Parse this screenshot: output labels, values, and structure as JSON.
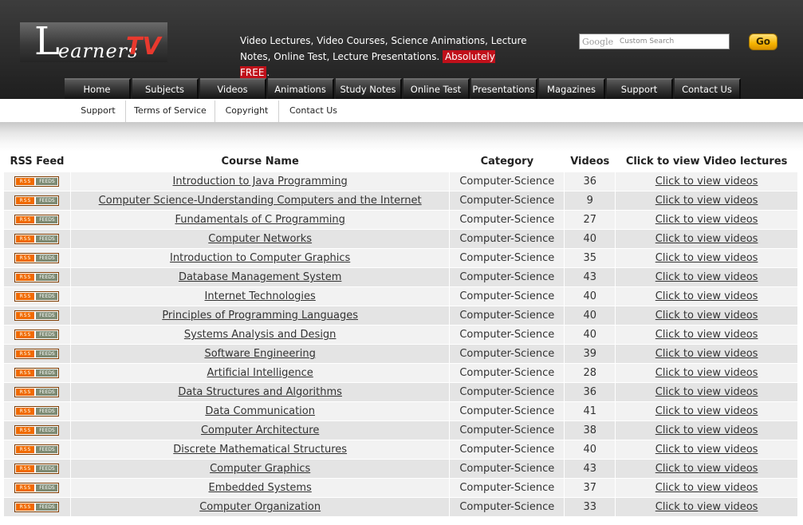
{
  "brand": {
    "logo_l": "L",
    "logo_learners": "earners",
    "logo_tv": "TV"
  },
  "tagline": {
    "text": "Video Lectures, Video Courses, Science Animations, Lecture Notes, Online Test, Lecture Presentations.",
    "highlight": "Absolutely FREE",
    "end": "."
  },
  "search": {
    "google_mark": "Google",
    "custom_search": "Custom Search",
    "go_label": "Go"
  },
  "nav": [
    {
      "label": "Home"
    },
    {
      "label": "Subjects"
    },
    {
      "label": "Videos"
    },
    {
      "label": "Animations"
    },
    {
      "label": "Study Notes"
    },
    {
      "label": "Online Test"
    },
    {
      "label": "Presentations"
    },
    {
      "label": "Magazines"
    },
    {
      "label": "Support"
    },
    {
      "label": "Contact Us"
    }
  ],
  "subnav": [
    {
      "label": "Support"
    },
    {
      "label": "Terms of Service"
    },
    {
      "label": "Copyright"
    },
    {
      "label": "Contact Us"
    }
  ],
  "table": {
    "headers": [
      "RSS Feed",
      "Course Name",
      "Category",
      "Videos",
      "Click to view Video lectures"
    ],
    "rss_left": "RSS",
    "rss_right": "FEEDS",
    "link_text": "Click to view videos",
    "rows": [
      {
        "course": "Introduction to Java Programming",
        "category": "Computer-Science",
        "videos": "36"
      },
      {
        "course": "Computer Science-Understanding Computers and the Internet",
        "category": "Computer-Science",
        "videos": "9"
      },
      {
        "course": "Fundamentals of C Programming",
        "category": "Computer-Science",
        "videos": "27"
      },
      {
        "course": "Computer Networks",
        "category": "Computer-Science",
        "videos": "40"
      },
      {
        "course": "Introduction to Computer Graphics",
        "category": "Computer-Science",
        "videos": "35"
      },
      {
        "course": "Database Management System",
        "category": "Computer-Science",
        "videos": "43"
      },
      {
        "course": "Internet Technologies",
        "category": "Computer-Science",
        "videos": "40"
      },
      {
        "course": "Principles of Programming Languages",
        "category": "Computer-Science",
        "videos": "40"
      },
      {
        "course": "Systems Analysis and Design",
        "category": "Computer-Science",
        "videos": "40"
      },
      {
        "course": "Software Engineering",
        "category": "Computer-Science",
        "videos": "39"
      },
      {
        "course": "Artificial Intelligence",
        "category": "Computer-Science",
        "videos": "28"
      },
      {
        "course": "Data Structures and Algorithms",
        "category": "Computer-Science",
        "videos": "36"
      },
      {
        "course": "Data Communication",
        "category": "Computer-Science",
        "videos": "41"
      },
      {
        "course": "Computer Architecture",
        "category": "Computer-Science",
        "videos": "38"
      },
      {
        "course": "Discrete Mathematical Structures",
        "category": "Computer-Science",
        "videos": "40"
      },
      {
        "course": "Computer Graphics",
        "category": "Computer-Science",
        "videos": "43"
      },
      {
        "course": "Embedded Systems",
        "category": "Computer-Science",
        "videos": "37"
      },
      {
        "course": "Computer Organization",
        "category": "Computer-Science",
        "videos": "33"
      }
    ]
  },
  "colors": {
    "header_dark": "#2f2f2f",
    "free_badge": "#c0101a",
    "logo_tv": "#e8392e",
    "go_button": "#f7b500",
    "rss_orange": "#f06a00",
    "row_light": "#f2f2f2",
    "row_dark": "#e4e4e4"
  },
  "icons": {
    "rss_badge": "rss-feed-icon"
  }
}
